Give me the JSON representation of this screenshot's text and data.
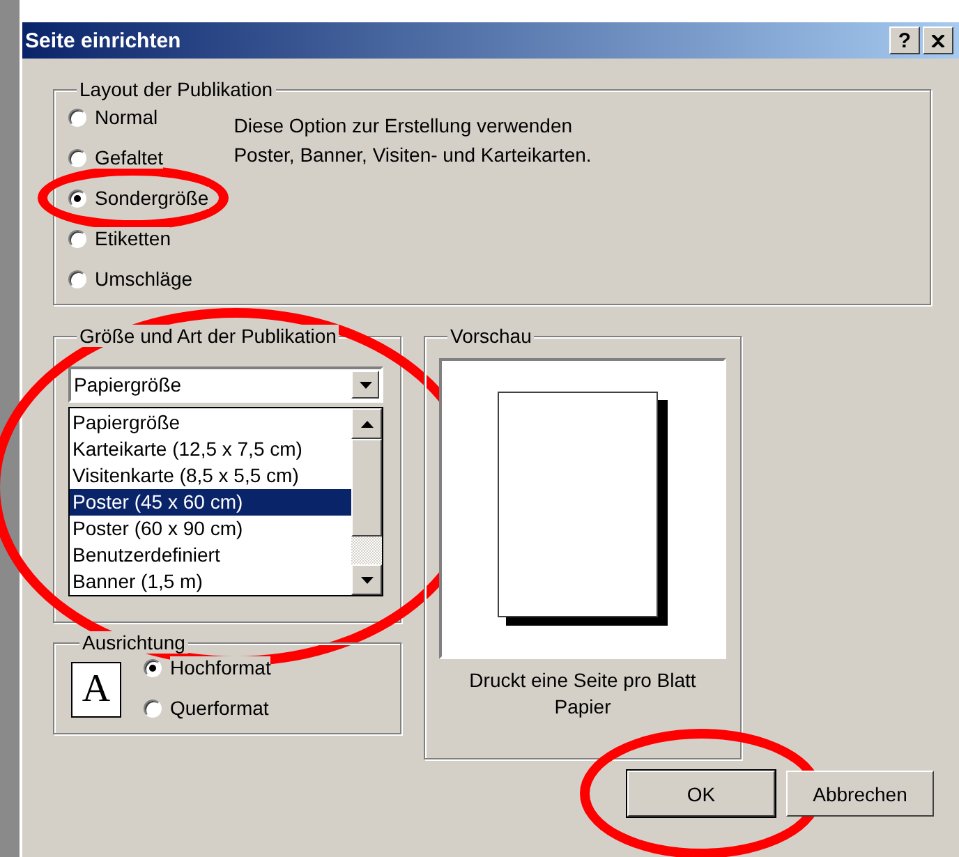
{
  "window": {
    "title": "Seite einrichten",
    "help_button": "?"
  },
  "layout": {
    "title": "Layout der Publikation",
    "options": [
      {
        "label": "Normal",
        "selected": false,
        "circled": false
      },
      {
        "label": "Gefaltet",
        "selected": false,
        "circled": false
      },
      {
        "label": "Sondergröße",
        "selected": true,
        "circled": true
      },
      {
        "label": "Etiketten",
        "selected": false,
        "circled": false
      },
      {
        "label": "Umschläge",
        "selected": false,
        "circled": false
      }
    ],
    "description": [
      "Diese Option zur Erstellung verwenden",
      "Poster, Banner, Visiten- und Karteikarten."
    ]
  },
  "size": {
    "title": "Größe und Art der Publikation",
    "circled": true,
    "combo": {
      "value": "Papiergröße"
    },
    "list": [
      {
        "label": "Papiergröße",
        "selected": false
      },
      {
        "label": "Karteikarte (12,5 x 7,5 cm)",
        "selected": false
      },
      {
        "label": "Visitenkarte (8,5 x 5,5 cm)",
        "selected": false
      },
      {
        "label": "Poster (45 x 60 cm)",
        "selected": true
      },
      {
        "label": "Poster (60 x 90 cm)",
        "selected": false
      },
      {
        "label": "Benutzerdefiniert",
        "selected": false
      },
      {
        "label": "Banner (1,5 m)",
        "selected": false
      }
    ]
  },
  "orientation": {
    "title": "Ausrichtung",
    "preview_letter": "A",
    "options": [
      {
        "label": "Hochformat",
        "selected": true
      },
      {
        "label": "Querformat",
        "selected": false
      }
    ]
  },
  "preview": {
    "title": "Vorschau",
    "caption": "Druckt eine Seite pro Blatt Papier"
  },
  "buttons": [
    {
      "label": "OK",
      "default": true,
      "circled": true
    },
    {
      "label": "Abbrechen",
      "default": false,
      "circled": false
    }
  ]
}
